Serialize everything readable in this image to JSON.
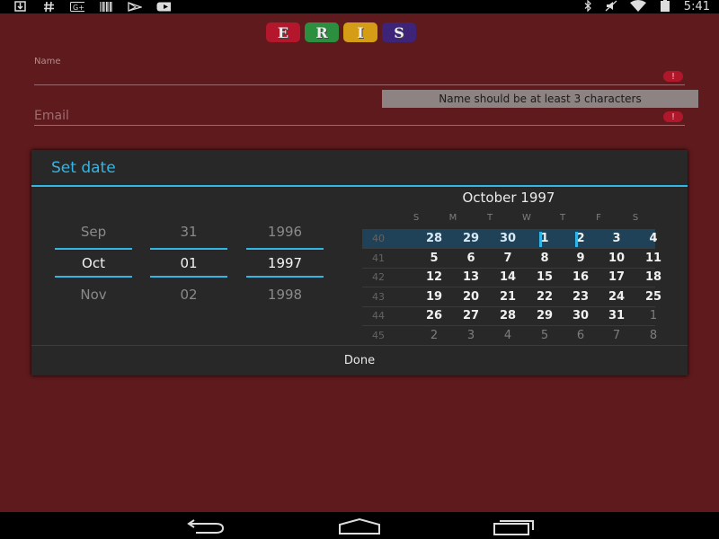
{
  "status_bar": {
    "left_icons": [
      "download-icon",
      "hashtag-icon",
      "google-plus-icon",
      "barcode-icon",
      "play-store-icon",
      "youtube-icon"
    ],
    "right_icons": [
      "bluetooth-icon",
      "mute-icon",
      "wifi-icon",
      "battery-icon"
    ],
    "time": "5:41"
  },
  "app": {
    "logo_letters": [
      "E",
      "R",
      "I",
      "S"
    ],
    "logo_colors": [
      "#b4162c",
      "#2c8f3f",
      "#f1b316",
      "#3d2478"
    ],
    "name_label": "Name",
    "email_label": "Email",
    "error_icon": "!",
    "name_error": "Name should be at least 3 characters"
  },
  "dialog": {
    "title": "Set date",
    "spinners": {
      "month": {
        "prev": "Sep",
        "current": "Oct",
        "next": "Nov"
      },
      "day": {
        "prev": "31",
        "current": "01",
        "next": "02"
      },
      "year": {
        "prev": "1996",
        "current": "1997",
        "next": "1998"
      }
    },
    "calendar": {
      "month_title": "October 1997",
      "weekdays": [
        "S",
        "M",
        "T",
        "W",
        "T",
        "F",
        "S"
      ],
      "weeks": [
        {
          "num": "40",
          "days": [
            "28",
            "29",
            "30",
            "1",
            "2",
            "3",
            "4"
          ],
          "other": [
            true,
            true,
            true,
            false,
            false,
            false,
            false
          ],
          "selected": true
        },
        {
          "num": "41",
          "days": [
            "5",
            "6",
            "7",
            "8",
            "9",
            "10",
            "11"
          ],
          "other": [
            false,
            false,
            false,
            false,
            false,
            false,
            false
          ]
        },
        {
          "num": "42",
          "days": [
            "12",
            "13",
            "14",
            "15",
            "16",
            "17",
            "18"
          ],
          "other": [
            false,
            false,
            false,
            false,
            false,
            false,
            false
          ]
        },
        {
          "num": "43",
          "days": [
            "19",
            "20",
            "21",
            "22",
            "23",
            "24",
            "25"
          ],
          "other": [
            false,
            false,
            false,
            false,
            false,
            false,
            false
          ]
        },
        {
          "num": "44",
          "days": [
            "26",
            "27",
            "28",
            "29",
            "30",
            "31",
            "1"
          ],
          "other": [
            false,
            false,
            false,
            false,
            false,
            false,
            true
          ]
        },
        {
          "num": "45",
          "days": [
            "2",
            "3",
            "4",
            "5",
            "6",
            "7",
            "8"
          ],
          "other": [
            true,
            true,
            true,
            true,
            true,
            true,
            true
          ]
        }
      ]
    },
    "done_label": "Done"
  },
  "nav_bar": {
    "icons": [
      "back-icon",
      "home-icon",
      "recent-apps-icon"
    ]
  },
  "colors": {
    "background": "#5e1a1d",
    "accent": "#33b5e5",
    "dialog_bg": "#282828",
    "error": "#b0172b"
  }
}
